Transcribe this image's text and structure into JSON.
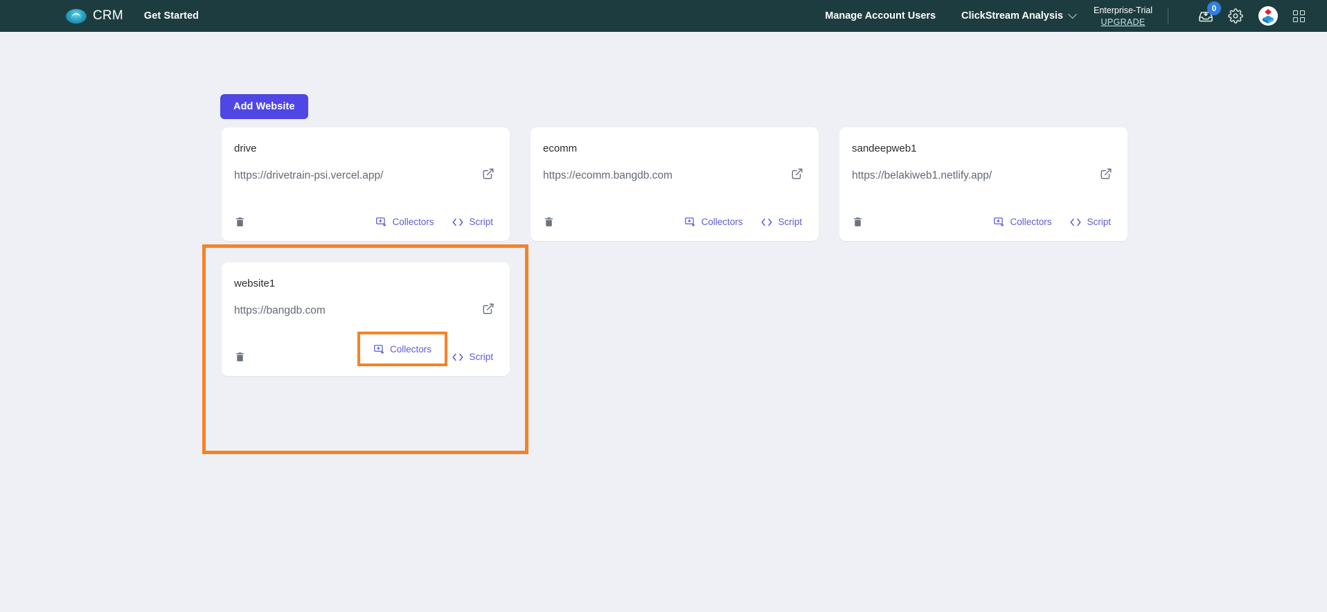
{
  "topbar": {
    "logo_icon": "crm-cloud-logo-icon",
    "brand": "CRM",
    "get_started": "Get Started",
    "manage_account_users": "Manage Account Users",
    "clickstream_analysis": "ClickStream Analysis",
    "chevron_icon": "chevron-down-icon",
    "plan_name": "Enterprise-Trial",
    "upgrade_label": "UPGRADE",
    "inbox_icon": "inbox-download-icon",
    "inbox_badge": "0",
    "settings_icon": "gear-icon",
    "avatar_icon": "user-avatar-icon",
    "apps_icon": "apps-grid-icon",
    "bg_color": "#1d3c3f",
    "badge_color": "#2f7fe0"
  },
  "main": {
    "add_website_label": "Add Website",
    "add_button_color": "#4f46e5",
    "background_color": "#eef0f5",
    "action_link_color": "#5b5bd6",
    "highlight_color": "#f68227",
    "cards": [
      {
        "title": "drive",
        "url": "https://drivetrain-psi.vercel.app/",
        "external_icon": "external-link-icon",
        "delete_icon": "trash-icon",
        "collectors_icon": "collectors-monitor-icon",
        "collectors_label": "Collectors",
        "script_icon": "code-brackets-icon",
        "script_label": "Script"
      },
      {
        "title": "ecomm",
        "url": "https://ecomm.bangdb.com",
        "external_icon": "external-link-icon",
        "delete_icon": "trash-icon",
        "collectors_icon": "collectors-monitor-icon",
        "collectors_label": "Collectors",
        "script_icon": "code-brackets-icon",
        "script_label": "Script"
      },
      {
        "title": "sandeepweb1",
        "url": "https://belakiweb1.netlify.app/",
        "external_icon": "external-link-icon",
        "delete_icon": "trash-icon",
        "collectors_icon": "collectors-monitor-icon",
        "collectors_label": "Collectors",
        "script_icon": "code-brackets-icon",
        "script_label": "Script"
      },
      {
        "title": "website1",
        "url": "https://bangdb.com",
        "external_icon": "external-link-icon",
        "delete_icon": "trash-icon",
        "collectors_icon": "collectors-monitor-icon",
        "collectors_label": "Collectors",
        "script_icon": "code-brackets-icon",
        "script_label": "Script"
      }
    ]
  },
  "annotations": {
    "outer_target": "website1-card-region",
    "inner_target": "collectors-button",
    "inner_label": "Collectors",
    "inner_icon": "collectors-monitor-icon"
  }
}
